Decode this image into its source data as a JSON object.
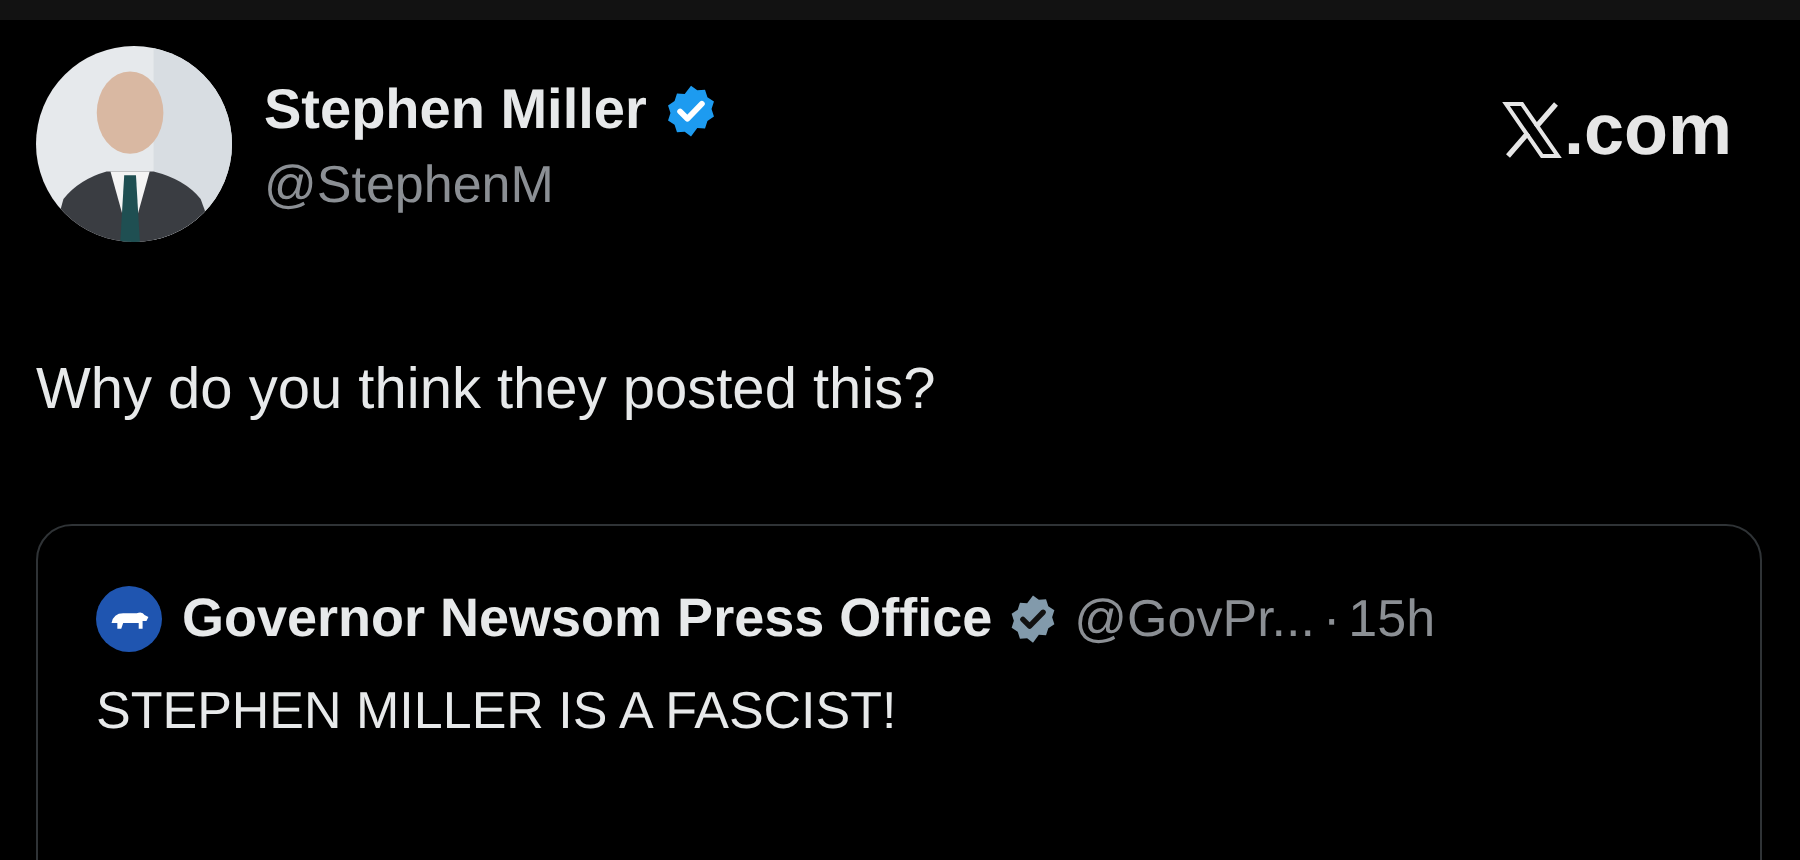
{
  "post": {
    "author": {
      "name": "Stephen Miller",
      "verified": true,
      "handle": "@StephenM"
    },
    "site": ".com",
    "text": "Why do you think they posted this?"
  },
  "quoted_post": {
    "author": {
      "name": "Governor Newsom Press Office",
      "verified": true,
      "handle": "@GovPr...",
      "separator": "·",
      "time": "15h"
    },
    "text": "STEPHEN MILLER IS A FASCIST!"
  }
}
